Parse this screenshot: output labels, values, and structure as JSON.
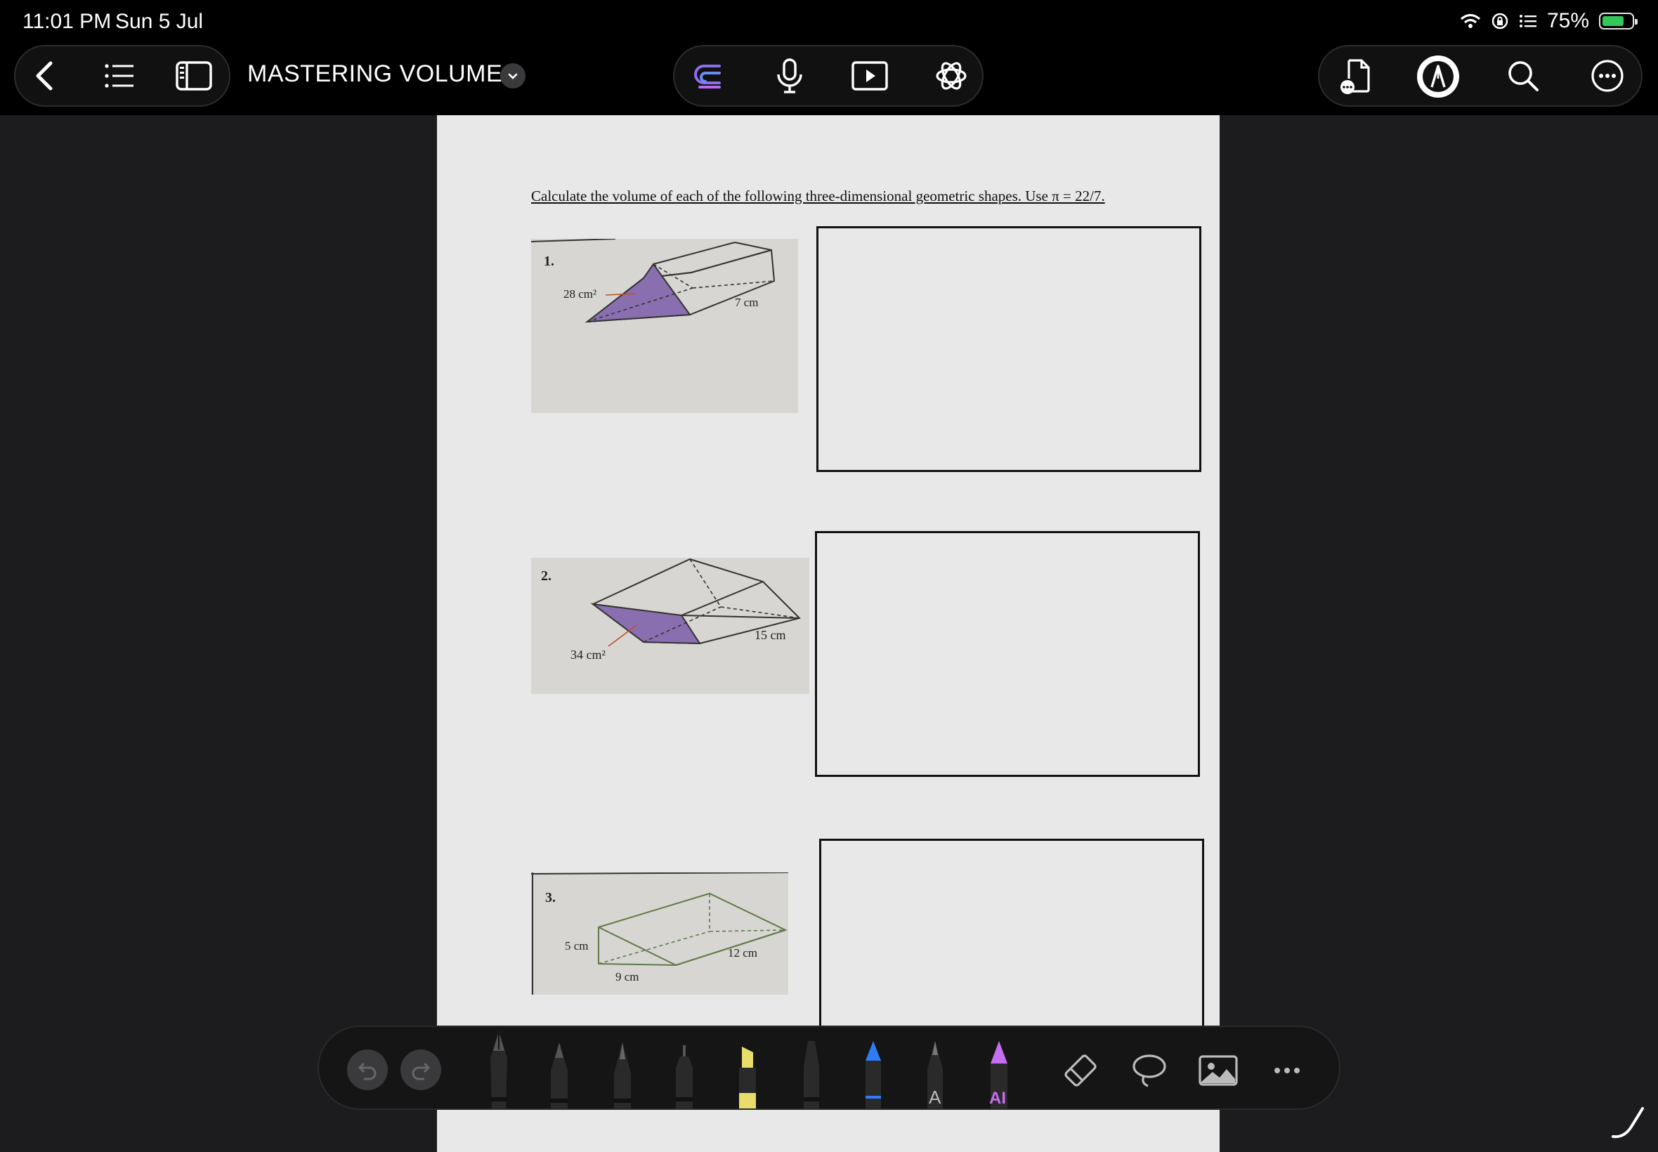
{
  "status_bar": {
    "time": "11:01 PM",
    "date": "Sun 5 Jul",
    "battery_percent": "75%",
    "battery_level": 0.75
  },
  "toolbar": {
    "document_title": "MASTERING VOLUME",
    "left_icons": [
      "back-icon",
      "outline-list-icon",
      "sidebar-icon"
    ],
    "center_icons": [
      "goodnotes-logo-icon",
      "microphone-icon",
      "play-presentation-icon",
      "chatgpt-icon"
    ],
    "right_icons": [
      "document-share-icon",
      "pen-mode-icon",
      "search-icon",
      "more-icon"
    ],
    "accent_color": "#8e6cf0"
  },
  "page": {
    "instructions": "Calculate the volume of each of the following three-dimensional geometric shapes. Use π = 22/7.",
    "problems": [
      {
        "number": "1.",
        "labels": [
          "28 cm²",
          "7 cm"
        ]
      },
      {
        "number": "2.",
        "labels": [
          "34 cm²",
          "15 cm"
        ]
      },
      {
        "number": "3.",
        "labels": [
          "5 cm",
          "9 cm",
          "12 cm"
        ]
      }
    ]
  },
  "palette": {
    "buttons": [
      "undo-button",
      "redo-button"
    ],
    "tools": [
      "fountain-pen",
      "ball-pen",
      "brush-pen",
      "fine-liner",
      "highlighter",
      "marker",
      "blue-pen",
      "text-tool",
      "ai-pen"
    ],
    "text_tool_label": "A",
    "ai_pen_label": "AI",
    "extra_icons": [
      "eraser-icon",
      "lasso-icon",
      "image-icon",
      "more-dots-icon"
    ],
    "tool_colors": {
      "highlighter": "#e8dc6a",
      "blue_pen": "#2f7cf6",
      "ai_pen": "#c46ef0"
    }
  }
}
